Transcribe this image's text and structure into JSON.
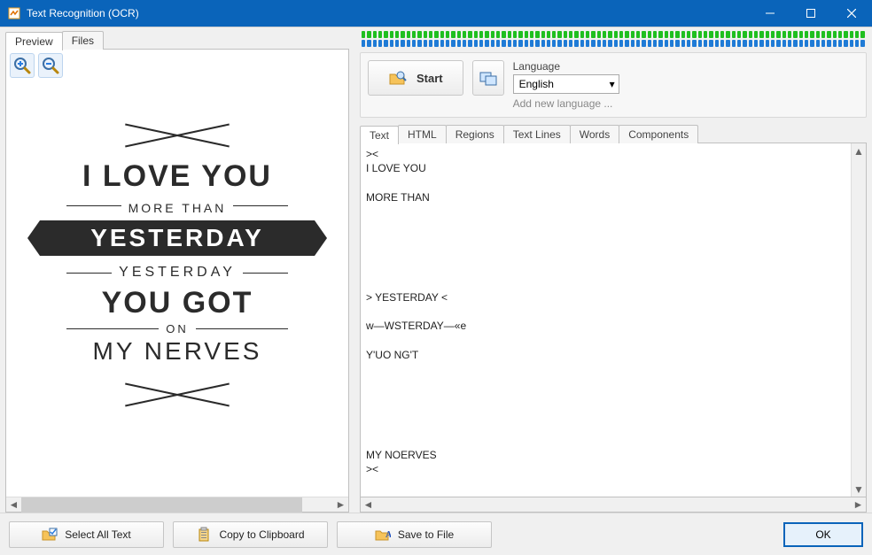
{
  "window": {
    "title": "Text Recognition (OCR)"
  },
  "left": {
    "tabs": {
      "preview": "Preview",
      "files": "Files"
    },
    "image_text": {
      "line1": "I LOVE YOU",
      "more": "MORE THAN",
      "yesterday_banner": "YESTERDAY",
      "yesterday_small": "YESTERDAY",
      "yougot": "YOU GOT",
      "on": "ON",
      "nerves": "MY NERVES"
    }
  },
  "right": {
    "start_label": "Start",
    "language_label": "Language",
    "language_value": "English",
    "add_language": "Add new language ...",
    "tabs": {
      "text": "Text",
      "html": "HTML",
      "regions": "Regions",
      "textlines": "Text Lines",
      "words": "Words",
      "components": "Components"
    },
    "ocr_output": "><\nI LOVE YOU\n\nMORE THAN\n\n\n\n\n\n\n> YESTERDAY <\n\nw—WSTERDAY—«e\n\nY'UO NG'T\n\n\n\n\n\n\nMY NOERVES\n><"
  },
  "footer": {
    "select_all": "Select All Text",
    "copy": "Copy to Clipboard",
    "save": "Save to File",
    "ok": "OK"
  }
}
